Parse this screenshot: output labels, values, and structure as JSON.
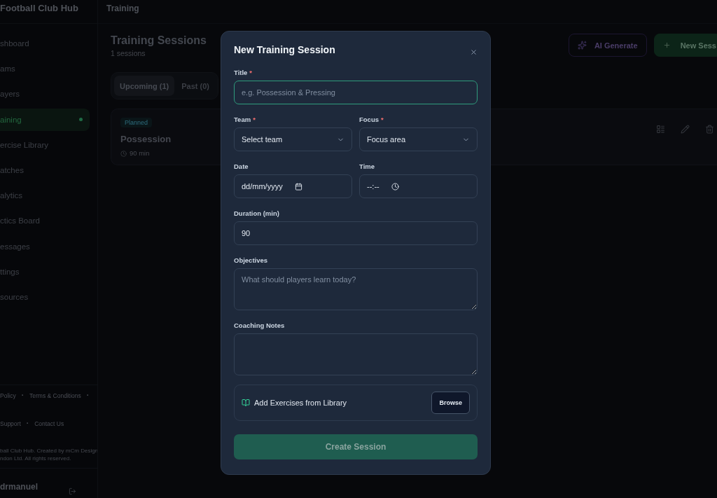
{
  "header": {
    "brand": "Football Club Hub",
    "breadcrumb": "Training"
  },
  "sidebar": {
    "items": [
      {
        "label": "shboard",
        "selected": false
      },
      {
        "label": "ams",
        "selected": false
      },
      {
        "label": "ayers",
        "selected": false
      },
      {
        "label": "aining",
        "selected": true
      },
      {
        "label": "ercise Library",
        "selected": false
      },
      {
        "label": "atches",
        "selected": false
      },
      {
        "label": "alytics",
        "selected": false
      },
      {
        "label": "ctics Board",
        "selected": false
      },
      {
        "label": "essages",
        "selected": false
      },
      {
        "label": "ttings",
        "selected": false
      },
      {
        "label": "sources",
        "selected": false
      }
    ],
    "footer_lines": [
      [
        {
          "kind": "link",
          "text": "Policy"
        },
        {
          "kind": "separator",
          "text": "·"
        },
        {
          "kind": "link",
          "text": "Terms & Conditions"
        },
        {
          "kind": "separator",
          "text": "·"
        }
      ],
      [
        {
          "kind": "link",
          "text": "Support"
        },
        {
          "kind": "separator",
          "text": "·"
        },
        {
          "kind": "link",
          "text": "Contact Us"
        }
      ]
    ],
    "copyright_lines": [
      "ball Club Hub. Created by mCm Design",
      "ndon Ltd. All rights reserved."
    ],
    "user": {
      "name": "drmanuel"
    }
  },
  "main": {
    "title": "Training Sessions",
    "subtitle": "1 sessions",
    "actions": [
      {
        "kind": "ai",
        "label": "AI Generate"
      },
      {
        "kind": "primary",
        "label": "New Sess"
      }
    ],
    "tabs": [
      {
        "label": "Upcoming (1)",
        "selected": true
      },
      {
        "label": "Past (0)",
        "selected": false
      }
    ],
    "sessions": [
      {
        "status": "Planned",
        "title": "Possession",
        "duration": "90 min"
      }
    ]
  },
  "modal": {
    "title": "New Training Session",
    "rows": [
      [
        {
          "kind": "text",
          "label": "Title",
          "required_mark": "*",
          "placeholder": "e.g. Possession & Pressing",
          "focused": true
        }
      ],
      [
        {
          "kind": "select",
          "label": "Team",
          "required_mark": "*",
          "value": "Select team",
          "focused": false
        },
        {
          "kind": "select",
          "label": "Focus",
          "required_mark": "*",
          "value": "Focus area",
          "focused": false
        }
      ],
      [
        {
          "kind": "date",
          "label": "Date",
          "value": "dd/mm/yyyy",
          "focused": false
        },
        {
          "kind": "time",
          "label": "Time",
          "value": "--:--",
          "focused": false
        }
      ],
      [
        {
          "kind": "text",
          "label": "Duration (min)",
          "value": "90",
          "focused": false
        }
      ],
      [
        {
          "kind": "textarea",
          "label": "Objectives",
          "placeholder": "What should players learn today?",
          "focused": false
        }
      ],
      [
        {
          "kind": "textarea",
          "label": "Coaching Notes",
          "focused": false
        }
      ]
    ],
    "library": {
      "label": "Add Exercises from Library",
      "button": "Browse"
    },
    "submit": {
      "label": "Create Session",
      "disabled": true
    }
  }
}
